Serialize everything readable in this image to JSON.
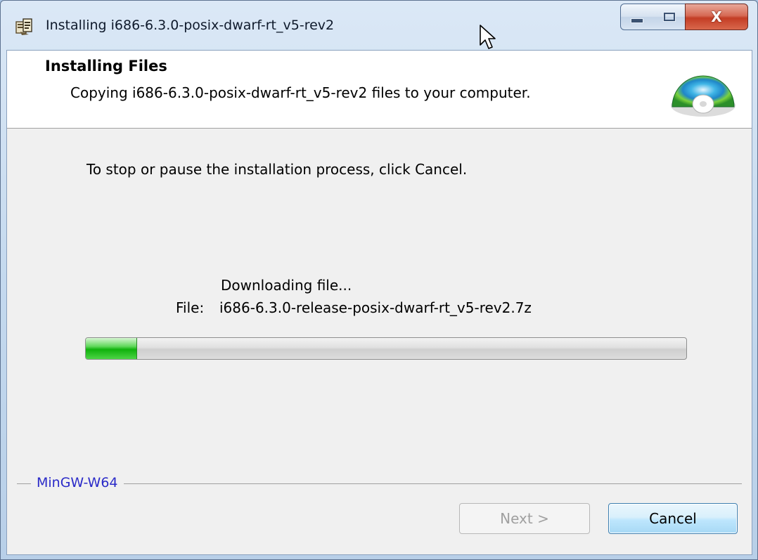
{
  "window": {
    "title": "Installing i686-6.3.0-posix-dwarf-rt_v5-rev2",
    "icon": "installer-icon",
    "controls": {
      "minimize": "minimize-icon",
      "maximize": "maximize-icon",
      "close_label": "X"
    }
  },
  "header": {
    "title": "Installing Files",
    "subtitle": "Copying i686-6.3.0-posix-dwarf-rt_v5-rev2 files to your computer.",
    "icon": "cd-disc-icon"
  },
  "body": {
    "instruction": "To stop or pause the installation process, click Cancel.",
    "status": "Downloading file...",
    "file_label": "File:",
    "file_name": "i686-6.3.0-release-posix-dwarf-rt_v5-rev2.7z",
    "progress_fraction": 0.085
  },
  "footer": {
    "brand": "MinGW-W64",
    "next_label": "Next >",
    "cancel_label": "Cancel"
  },
  "colors": {
    "brand_text": "#2a2ac8",
    "progress_green": "#0fb20c",
    "close_button": "#c33d25"
  }
}
